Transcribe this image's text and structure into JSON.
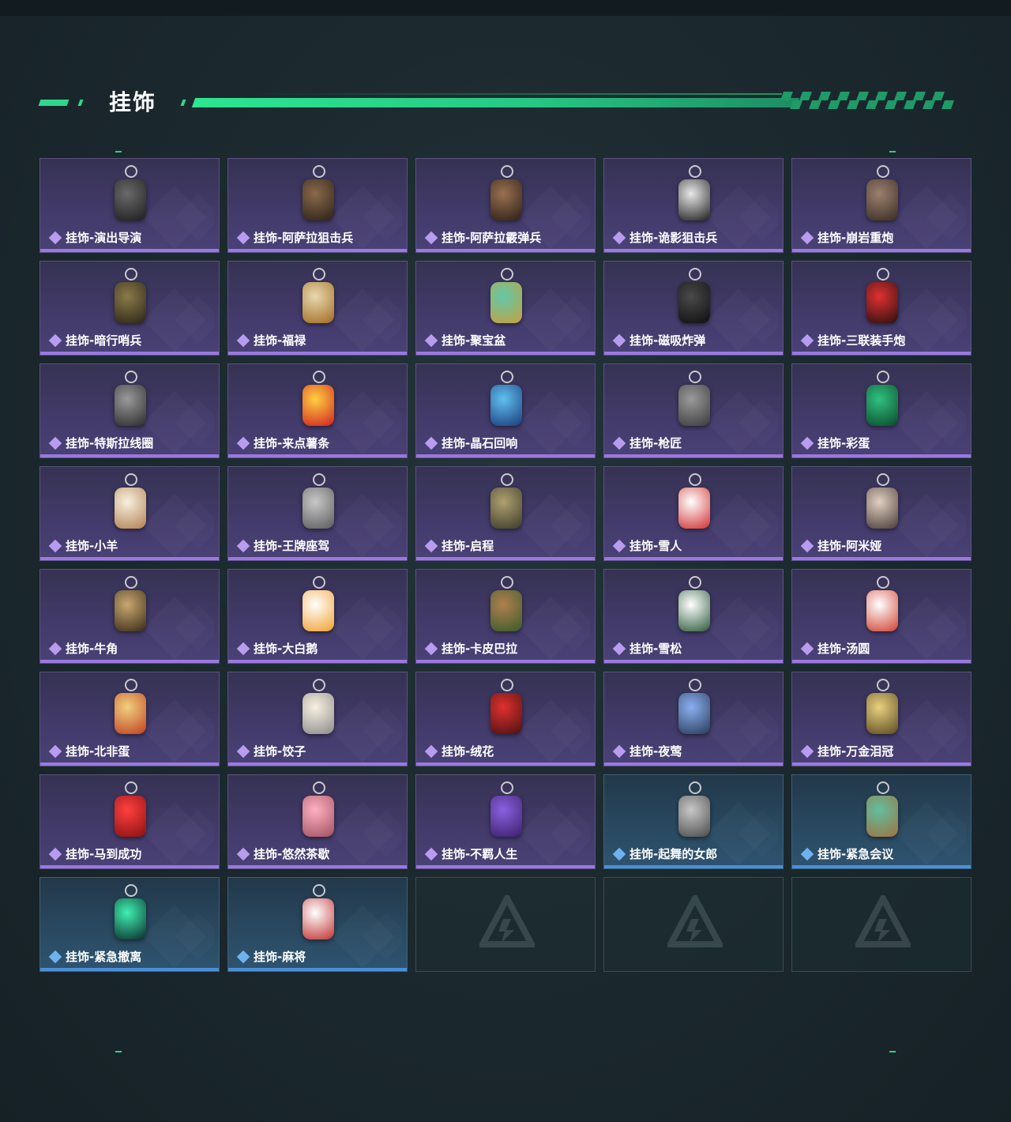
{
  "section": {
    "title": "挂饰"
  },
  "colors": {
    "accent": "#2ed98c",
    "purple_rarity": "#9a79e0",
    "blue_rarity": "#4b8fd8"
  },
  "items": [
    {
      "label": "挂饰-演出导演",
      "rarity": "purple",
      "icon": "soldier-figure-charm",
      "c1": "#6a6a6a",
      "c2": "#1d1d1d"
    },
    {
      "label": "挂饰-阿萨拉狙击兵",
      "rarity": "purple",
      "icon": "sniper-figure-charm",
      "c1": "#8a6a4a",
      "c2": "#2a2018"
    },
    {
      "label": "挂饰-阿萨拉霰弹兵",
      "rarity": "purple",
      "icon": "shotgunner-figure-charm",
      "c1": "#9a7050",
      "c2": "#2a1e16"
    },
    {
      "label": "挂饰-诡影狙击兵",
      "rarity": "purple",
      "icon": "masked-sniper-charm",
      "c1": "#e8e8e8",
      "c2": "#1e1e1e"
    },
    {
      "label": "挂饰-崩岩重炮",
      "rarity": "purple",
      "icon": "heavy-gunner-charm",
      "c1": "#9a8070",
      "c2": "#3a2c22"
    },
    {
      "label": "挂饰-暗行哨兵",
      "rarity": "purple",
      "icon": "sentry-figure-charm",
      "c1": "#8a7a4a",
      "c2": "#2a2416"
    },
    {
      "label": "挂饰-福禄",
      "rarity": "purple",
      "icon": "gourd-charm",
      "c1": "#e8d8b0",
      "c2": "#a06a20"
    },
    {
      "label": "挂饰-聚宝盆",
      "rarity": "purple",
      "icon": "treasure-bowl-charm",
      "c1": "#60c8a8",
      "c2": "#c8a040"
    },
    {
      "label": "挂饰-磁吸炸弹",
      "rarity": "purple",
      "icon": "magnetic-bomb-charm",
      "c1": "#4a4a4a",
      "c2": "#0e0e0e"
    },
    {
      "label": "挂饰-三联装手炮",
      "rarity": "purple",
      "icon": "hand-cannon-charm",
      "c1": "#e03030",
      "c2": "#2a1010"
    },
    {
      "label": "挂饰-特斯拉线圈",
      "rarity": "purple",
      "icon": "tesla-coil-charm",
      "c1": "#9a9a9a",
      "c2": "#2a2a2a"
    },
    {
      "label": "挂饰-来点薯条",
      "rarity": "purple",
      "icon": "fries-charm",
      "c1": "#ffd040",
      "c2": "#d02020"
    },
    {
      "label": "挂饰-晶石回响",
      "rarity": "purple",
      "icon": "crystal-charm",
      "c1": "#60c0f0",
      "c2": "#1a3a7a"
    },
    {
      "label": "挂饰-枪匠",
      "rarity": "purple",
      "icon": "gunsmith-tag-charm",
      "c1": "#9a9a9a",
      "c2": "#3a3a3a"
    },
    {
      "label": "挂饰-彩蛋",
      "rarity": "purple",
      "icon": "easter-egg-charm",
      "c1": "#30c080",
      "c2": "#0a4a2a"
    },
    {
      "label": "挂饰-小羊",
      "rarity": "purple",
      "icon": "lamb-charm",
      "c1": "#f8f0e0",
      "c2": "#b08050"
    },
    {
      "label": "挂饰-王牌座驾",
      "rarity": "purple",
      "icon": "jet-plane-charm",
      "c1": "#c8c8c8",
      "c2": "#5a5a5a"
    },
    {
      "label": "挂饰-启程",
      "rarity": "purple",
      "icon": "emblem-ring-charm",
      "c1": "#b0a070",
      "c2": "#3a3a2a"
    },
    {
      "label": "挂饰-雪人",
      "rarity": "purple",
      "icon": "snowman-charm",
      "c1": "#ffffff",
      "c2": "#d03030"
    },
    {
      "label": "挂饰-阿米娅",
      "rarity": "purple",
      "icon": "bunny-ears-charm",
      "c1": "#e0d0c0",
      "c2": "#4a3a3a"
    },
    {
      "label": "挂饰-牛角",
      "rarity": "purple",
      "icon": "bull-horns-charm",
      "c1": "#c8a870",
      "c2": "#3a2a18"
    },
    {
      "label": "挂饰-大白鹅",
      "rarity": "purple",
      "icon": "white-goose-charm",
      "c1": "#ffffff",
      "c2": "#f0a030"
    },
    {
      "label": "挂饰-卡皮巴拉",
      "rarity": "purple",
      "icon": "capybara-charm",
      "c1": "#b08050",
      "c2": "#3a5a2a"
    },
    {
      "label": "挂饰-雪松",
      "rarity": "purple",
      "icon": "snow-pine-charm",
      "c1": "#ffffff",
      "c2": "#2a5a3a"
    },
    {
      "label": "挂饰-汤圆",
      "rarity": "purple",
      "icon": "rice-ball-soup-charm",
      "c1": "#ffffff",
      "c2": "#d04030"
    },
    {
      "label": "挂饰-北非蛋",
      "rarity": "purple",
      "icon": "shakshuka-charm",
      "c1": "#f0d080",
      "c2": "#c04020"
    },
    {
      "label": "挂饰-饺子",
      "rarity": "purple",
      "icon": "dumplings-charm",
      "c1": "#f8f0e0",
      "c2": "#8a8a8a"
    },
    {
      "label": "挂饰-绒花",
      "rarity": "purple",
      "icon": "velvet-flower-charm",
      "c1": "#e03030",
      "c2": "#4a1010"
    },
    {
      "label": "挂饰-夜莺",
      "rarity": "purple",
      "icon": "feather-charm",
      "c1": "#8ab0f0",
      "c2": "#2a3a5a"
    },
    {
      "label": "挂饰-万金泪冠",
      "rarity": "purple",
      "icon": "golden-crown-charm",
      "c1": "#e8d080",
      "c2": "#5a4a20"
    },
    {
      "label": "挂饰-马到成功",
      "rarity": "purple",
      "icon": "red-horse-charm",
      "c1": "#ff4040",
      "c2": "#8a1010"
    },
    {
      "label": "挂饰-悠然茶歇",
      "rarity": "purple",
      "icon": "cupcake-charm",
      "c1": "#ffb0c0",
      "c2": "#a05060"
    },
    {
      "label": "挂饰-不羁人生",
      "rarity": "purple",
      "icon": "sneaker-charm",
      "c1": "#8a60e0",
      "c2": "#3a206a"
    },
    {
      "label": "挂饰-起舞的女郎",
      "rarity": "blue",
      "icon": "dancer-statue-charm",
      "c1": "#c8c8c8",
      "c2": "#4a4a4a"
    },
    {
      "label": "挂饰-紧急会议",
      "rarity": "blue",
      "icon": "meeting-badge-charm",
      "c1": "#60c0a0",
      "c2": "#a07040"
    },
    {
      "label": "挂饰-紧急撤离",
      "rarity": "blue",
      "icon": "exit-sign-charm",
      "c1": "#40f0b0",
      "c2": "#0a2a2a"
    },
    {
      "label": "挂饰-麻将",
      "rarity": "blue",
      "icon": "mahjong-tile-charm",
      "c1": "#ffffff",
      "c2": "#c03030"
    },
    {
      "label": "",
      "rarity": "empty",
      "icon": "empty-slot-logo"
    },
    {
      "label": "",
      "rarity": "empty",
      "icon": "empty-slot-logo"
    },
    {
      "label": "",
      "rarity": "empty",
      "icon": "empty-slot-logo"
    }
  ]
}
